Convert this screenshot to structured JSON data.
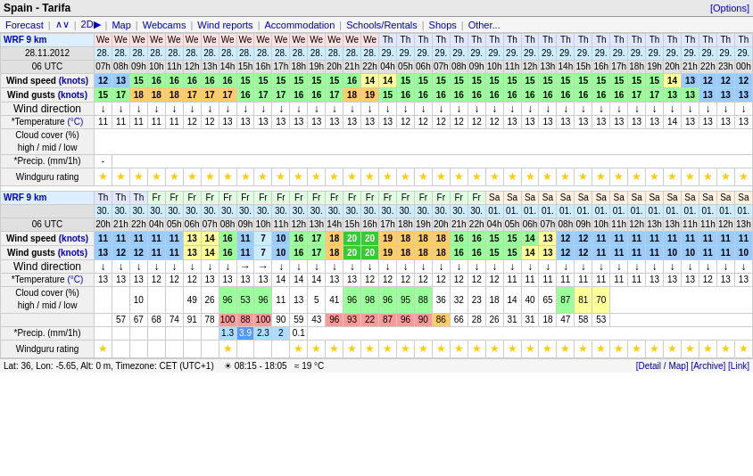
{
  "title": "Spain - Tarifa",
  "options_link": "[Options]",
  "nav": {
    "items": [
      "Forecast",
      "∧∨",
      "2D▶",
      "Map",
      "Webcams",
      "Wind reports",
      "Accommodation",
      "Schools/Rentals",
      "Shops",
      "Other..."
    ]
  },
  "bottom": {
    "left": "Lat: 36, Lon: -5.65, Alt: 0 m, Timezone: CET (UTC+1)",
    "sun": "☀ 08:15 - 18:05",
    "temp": "≈ 19 °C",
    "right_links": "[Detail / Map] [Archive] [Link]"
  },
  "section1": {
    "header": "WRF 9 km",
    "subheader": "28.11.2012",
    "utc": "06 UTC"
  },
  "section2": {
    "header": "WRF 9 km",
    "subheader": "",
    "utc": "06 UTC"
  }
}
